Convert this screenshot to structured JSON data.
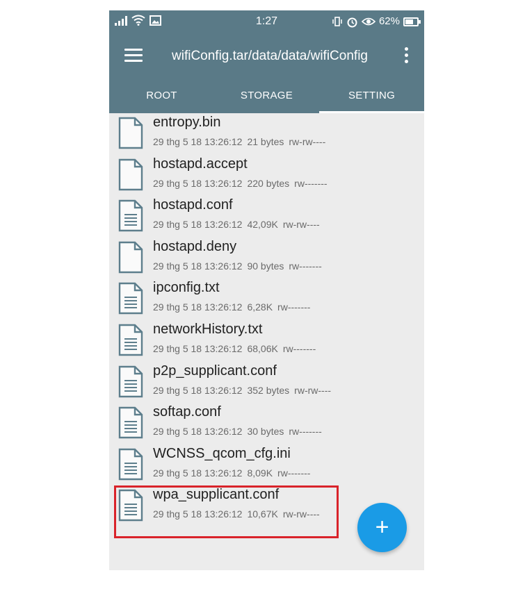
{
  "status_bar": {
    "time": "1:27",
    "battery": "62%"
  },
  "toolbar": {
    "title": "wifiConfig.tar/data/data/wifiConfig",
    "menu_icon": "hamburger-menu-icon",
    "more_icon": "more-vertical-icon"
  },
  "tabs": [
    {
      "label": "ROOT",
      "active": false
    },
    {
      "label": "STORAGE",
      "active": false
    },
    {
      "label": "SETTING",
      "active": true
    }
  ],
  "files": [
    {
      "name": "entropy.bin",
      "date": "29 thg 5 18 13:26:12",
      "size": "21 bytes",
      "perm": "rw-rw----",
      "icon": "blank-file-icon"
    },
    {
      "name": "hostapd.accept",
      "date": "29 thg 5 18 13:26:12",
      "size": "220 bytes",
      "perm": "rw-------",
      "icon": "blank-file-icon"
    },
    {
      "name": "hostapd.conf",
      "date": "29 thg 5 18 13:26:12",
      "size": "42,09K",
      "perm": "rw-rw----",
      "icon": "text-file-icon"
    },
    {
      "name": "hostapd.deny",
      "date": "29 thg 5 18 13:26:12",
      "size": "90 bytes",
      "perm": "rw-------",
      "icon": "blank-file-icon"
    },
    {
      "name": "ipconfig.txt",
      "date": "29 thg 5 18 13:26:12",
      "size": "6,28K",
      "perm": "rw-------",
      "icon": "text-file-icon"
    },
    {
      "name": "networkHistory.txt",
      "date": "29 thg 5 18 13:26:12",
      "size": "68,06K",
      "perm": "rw-------",
      "icon": "text-file-icon"
    },
    {
      "name": "p2p_supplicant.conf",
      "date": "29 thg 5 18 13:26:12",
      "size": "352 bytes",
      "perm": "rw-rw----",
      "icon": "text-file-icon"
    },
    {
      "name": "softap.conf",
      "date": "29 thg 5 18 13:26:12",
      "size": "30 bytes",
      "perm": "rw-------",
      "icon": "text-file-icon"
    },
    {
      "name": "WCNSS_qcom_cfg.ini",
      "date": "29 thg 5 18 13:26:12",
      "size": "8,09K",
      "perm": "rw-------",
      "icon": "text-file-icon"
    },
    {
      "name": "wpa_supplicant.conf",
      "date": "29 thg 5 18 13:26:12",
      "size": "10,67K",
      "perm": "rw-rw----",
      "icon": "text-file-icon"
    }
  ],
  "fab": {
    "label": "+",
    "icon": "add-icon"
  },
  "colors": {
    "toolbar": "#5a7a87",
    "fab": "#1a9be6",
    "highlight": "#d9232a"
  }
}
